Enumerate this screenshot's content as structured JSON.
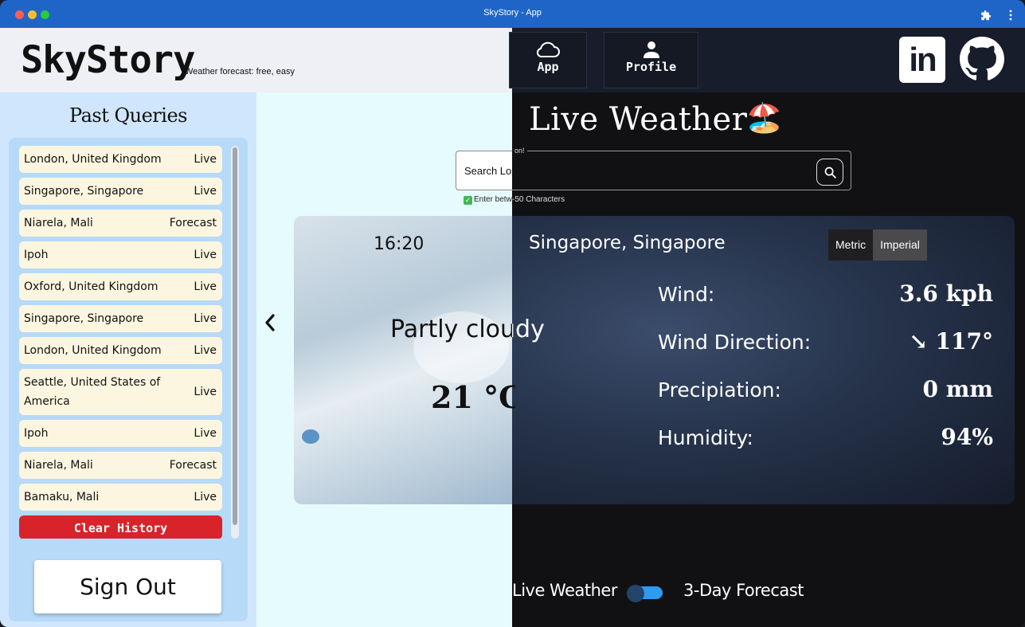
{
  "window": {
    "title": "SkyStory - App"
  },
  "header": {
    "logo": "SkyStory",
    "tagline": "Weather forecast: free, easy",
    "nav": [
      {
        "label": "App",
        "icon": "cloud-icon"
      },
      {
        "label": "Profile",
        "icon": "person-icon"
      }
    ],
    "social": {
      "linkedin_text": "in",
      "github_icon": "github-icon"
    }
  },
  "sidebar": {
    "title": "Past Queries",
    "queries": [
      {
        "location": "London, United Kingdom",
        "type": "Live"
      },
      {
        "location": "Singapore, Singapore",
        "type": "Live"
      },
      {
        "location": "Niarela, Mali",
        "type": "Forecast"
      },
      {
        "location": "Ipoh",
        "type": "Live"
      },
      {
        "location": "Oxford, United Kingdom",
        "type": "Live"
      },
      {
        "location": "Singapore, Singapore",
        "type": "Live"
      },
      {
        "location": "London, United Kingdom",
        "type": "Live"
      },
      {
        "location": "Seattle, United States of America",
        "type": "Live"
      },
      {
        "location": "Ipoh",
        "type": "Live"
      },
      {
        "location": "Niarela, Mali",
        "type": "Forecast"
      },
      {
        "location": "Bamaku, Mali",
        "type": "Live"
      }
    ],
    "clear_label": "Clear History",
    "signout_label": "Sign Out"
  },
  "main": {
    "title": "Live Weather",
    "title_emoji": "🏖️",
    "search": {
      "placeholder_visible": "Search Lo",
      "floating_label_visible": "on!",
      "hint_left": "Enter between 3",
      "hint_right": "-50 Characters"
    },
    "card": {
      "time": "16:20",
      "location": "Singapore, Singapore",
      "condition": "Partly cloudy",
      "temperature": "21 °C",
      "units": {
        "metric": "Metric",
        "imperial": "Imperial",
        "selected": "Metric"
      },
      "stats": [
        {
          "label": "Wind:",
          "value": "3.6 kph"
        },
        {
          "label": "Wind Direction:",
          "value": "↘ 117°"
        },
        {
          "label": "Precipiation:",
          "value": "0 mm"
        },
        {
          "label": "Humidity:",
          "value": "94%"
        }
      ]
    },
    "toggle": {
      "left_label": "Live Weather",
      "right_label": "3-Day Forecast",
      "state": "on"
    }
  },
  "colors": {
    "titlebar": "#1f65c7",
    "accent_blue": "#2d9bf0",
    "danger": "#d8232a",
    "list_item_bg": "#fcf6e0",
    "sidebar_bg": "#cfe6fc"
  }
}
